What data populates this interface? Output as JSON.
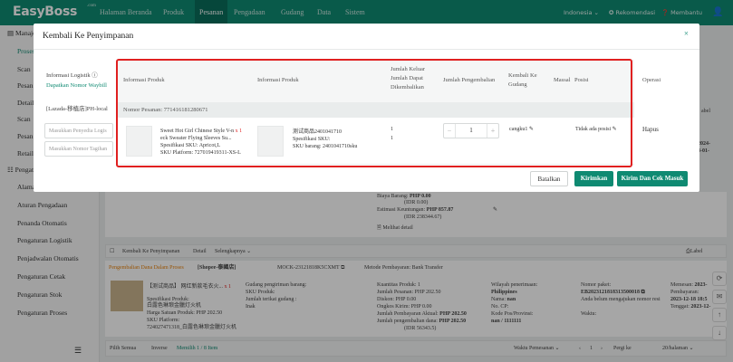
{
  "app": {
    "logo": "EasyBoss",
    "logo_suffix": ".com"
  },
  "nav": [
    "Halaman Beranda",
    "Produk",
    "Pesanan",
    "Pengadaan",
    "Gudang",
    "Data",
    "Sistem"
  ],
  "nav_active": "Pesanan",
  "topright": {
    "language": "Indonesia",
    "notifications": "Rekomendasi",
    "help": "Membantu"
  },
  "sidebar": {
    "group1": "Manajemen",
    "items_top": [
      "Proses",
      "Scan",
      "Pesan",
      "Detail",
      "Scan",
      "Pesan",
      "Retail"
    ],
    "group2": "Pengaturan",
    "items": [
      "Alamat",
      "Aturan Pengadaan",
      "Penanda Otomatis",
      "Pengaturan Logistik",
      "Penjadwalan Otomatis",
      "Pengaturan Cetak",
      "Pengaturan Stok",
      "Pengaturan Proses"
    ]
  },
  "modal": {
    "title": "Kembali Ke Penyimpanan",
    "close": "×",
    "logistics_info": "Informasi Logistik",
    "get_waybill": "Dapatkan Nomor Waybill",
    "shop": "[Lazada-移植店]PH-local",
    "input_provider_placeholder": "Masukkan Penyedia Logis",
    "input_tracking_placeholder": "Masukkan Nomor Tagihan",
    "headers": {
      "product_info_1": "Informasi Produk",
      "product_info_2": "Informasi Produk",
      "qty_returnable": "Jumlah Keluar Jumlah Dapat Dikembalikan",
      "qty_return": "Jumlah Pengembalian",
      "return_warehouse": "Kembali Ke Gudang",
      "manual": "Massal",
      "position": "Posisi",
      "operation": "Operasi"
    },
    "order_no": "Nomor Pesanan: 771416181280671",
    "row": {
      "p1_name_a": "Sweet Hot Girl Chinese Style V-n",
      "p1_qty_badge": "x 1",
      "p1_name_b": "eck Sweater Flying Sleeves Su...",
      "p1_spec_label": "Spesifikasi SKU:",
      "p1_spec": "Apricot,L",
      "p1_sku_label": "SKU Platform:",
      "p1_sku": "727019419311-XS-L",
      "p2_name": "测试商品2401041710",
      "p2_spec_label": "Spesifikasi SKU:",
      "p2_sku_label": "SKU barang:",
      "p2_sku": "2401041710sku",
      "qty_out": "1",
      "qty_returnable": "1",
      "qty_value": "1",
      "warehouse": "cangku1",
      "position": "Tidak ada posisi",
      "delete": "Hapus"
    },
    "buttons": {
      "cancel": "Batalkan",
      "submit": "Kirimkan",
      "submit_print": "Kirim Dan Cek Masuk"
    }
  },
  "background": {
    "cost_label": "Biaya Barang:",
    "cost": "PHP 0.00",
    "cost_idr": "(IDR 0.00)",
    "profit_label": "Estimasi Keuntungan:",
    "profit": "PHP 857.87",
    "profit_idr": "(IDR 238344.67)",
    "view_detail": "Melihat detail",
    "action_return": "Kembali Ke Penyimpanan",
    "action_detail": "Detail",
    "action_more": "Selengkapnya",
    "label_btn": "Label",
    "status_text": "Pengembalian Dana Dalam Proses",
    "shop_tag": "[Shopee-泰國店]",
    "order_id": "MOCK-23121818K5CXMT",
    "payment": "Metode Pembayaran: Bank Transfer",
    "item_name": "【测试商品】 网红新款毛衣火...",
    "item_qty": "x 1",
    "item_spec_label": "Spesifikasi Produk:",
    "item_spec": "白露色琳琅金臘灯火机",
    "item_price_label": "Harga Satuan Produk:",
    "item_price": "PHP 202.50",
    "item_sku_label": "SKU Platform:",
    "item_sku": "724027471318_白露色琳琅金臘灯火机",
    "ship_wh_label": "Gudang pengiriman barang:",
    "sku_prod": "SKU Produk:",
    "bound_wh": "Jumlah terikat gudang :",
    "none": "Inak",
    "qty_line": "Kuantitas Produk: 1",
    "total_label": "Jumlah Pesanan:",
    "total": "PHP 202.50",
    "disc_label": "Diskon:",
    "disc": "PHP 0.00",
    "ship_label": "Ongkos Kirim:",
    "ship": "PHP 0.00",
    "actual_label": "Jumlah Pembayaran Aktual:",
    "actual": "PHP 202.50",
    "refund_label": "Jumlah pengembalian dana:",
    "refund": "PHP 202.50",
    "refund_idr": "(IDR 56343.5)",
    "region_label": "Wilayah penerimaan:",
    "region": "Philippines",
    "name_label": "Nama:",
    "name": "nan",
    "phone_label": "No. CP:",
    "postal_label": "Kode Pos/Provinsi:",
    "postal": "nan / 1111111",
    "pkg_label": "Nomor paket:",
    "pkg": "EB2023121818313500018",
    "no_ship": "Anda belum mengajukan nomor resi",
    "time_label": "Waktu:",
    "buy_label": "Memesan:",
    "buy": "2023-",
    "pay_label": "Pembayaran:",
    "pay": "2023-12-18 18:5",
    "due_label": "Tenggat:",
    "due": "2023-12-",
    "side_date_a": "2024-",
    "side_date_b": "4-01-",
    "side_label": "abel",
    "bottom_select": "Pilih Semua",
    "bottom_invert": "Inverse",
    "bottom_selected": "Memilih 1 / 8 Item",
    "sort": "Waktu Pemesanan",
    "page_label": "Pergi ke",
    "page": "1",
    "per_page": "20/halaman"
  }
}
